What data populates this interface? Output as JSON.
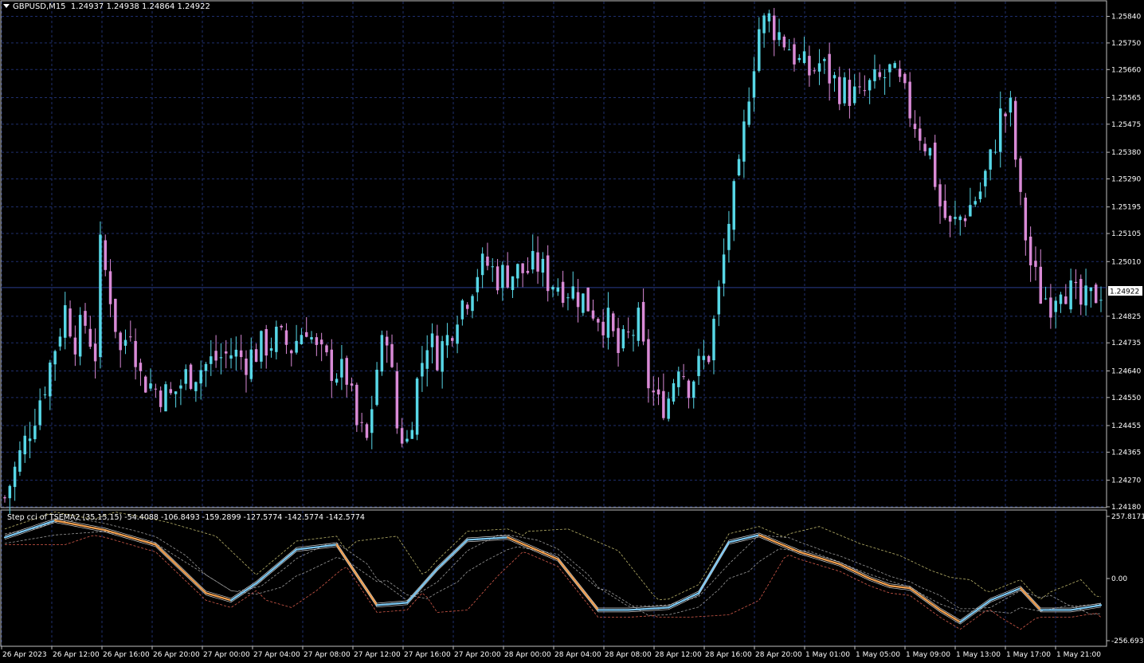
{
  "header": {
    "symbol": "GBPUSD,M15",
    "ohlc": "1.24937 1.24938 1.24864 1.24922"
  },
  "colors": {
    "background": "#000000",
    "grid": "#1f2f6e",
    "axis": "#c0c0c0",
    "bull_candle": "#57d7e6",
    "bear_candle": "#d98ad6",
    "current_price_line": "#2a3c8c",
    "cci_up": "#7dc8f2",
    "cci_down": "#f2a050",
    "band_yellow": "#b9b26a",
    "band_white": "#9a9a9a",
    "band_red": "#d35a4a"
  },
  "price_axis": {
    "labels": [
      "1.25840",
      "1.25750",
      "1.25660",
      "1.25565",
      "1.25475",
      "1.25380",
      "1.25290",
      "1.25195",
      "1.25105",
      "1.25010",
      "1.24825",
      "1.24735",
      "1.24640",
      "1.24550",
      "1.24455",
      "1.24365",
      "1.24270",
      "1.24180"
    ],
    "current_price": "1.24922"
  },
  "time_axis": {
    "labels": [
      "26 Apr 2023",
      "26 Apr 12:00",
      "26 Apr 16:00",
      "26 Apr 20:00",
      "27 Apr 00:00",
      "27 Apr 04:00",
      "27 Apr 08:00",
      "27 Apr 12:00",
      "27 Apr 16:00",
      "27 Apr 20:00",
      "28 Apr 00:00",
      "28 Apr 04:00",
      "28 Apr 08:00",
      "28 Apr 12:00",
      "28 Apr 16:00",
      "28 Apr 20:00",
      "1 May 01:00",
      "1 May 05:00",
      "1 May 09:00",
      "1 May 13:00",
      "1 May 17:00",
      "1 May 21:00"
    ]
  },
  "indicator": {
    "title": "Step cci of TSEMA2 (35,15,15) -54.4088 -106.8493 -159.2899 -127.5774 -142.5774 -142.5774",
    "axis_labels": [
      "257.8171",
      "0.00",
      "-256.6939"
    ]
  },
  "chart_data": {
    "type": "candlestick",
    "symbol": "GBPUSD",
    "timeframe": "M15",
    "ylim": [
      1.2418,
      1.2589
    ],
    "close_path": [
      [
        0,
        1.2421
      ],
      [
        4,
        1.244
      ],
      [
        8,
        1.246
      ],
      [
        12,
        1.2485
      ],
      [
        14,
        1.2475
      ],
      [
        16,
        1.248
      ],
      [
        18,
        1.247
      ],
      [
        19,
        1.2505
      ],
      [
        21,
        1.249
      ],
      [
        23,
        1.247
      ],
      [
        25,
        1.248
      ],
      [
        27,
        1.2462
      ],
      [
        30,
        1.2458
      ],
      [
        33,
        1.2455
      ],
      [
        36,
        1.2462
      ],
      [
        39,
        1.2465
      ],
      [
        42,
        1.2468
      ],
      [
        45,
        1.247
      ],
      [
        48,
        1.2468
      ],
      [
        51,
        1.2472
      ],
      [
        54,
        1.2475
      ],
      [
        57,
        1.2472
      ],
      [
        60,
        1.248
      ],
      [
        62,
        1.247
      ],
      [
        65,
        1.2465
      ],
      [
        68,
        1.2462
      ],
      [
        70,
        1.2445
      ],
      [
        72,
        1.244
      ],
      [
        74,
        1.2465
      ],
      [
        76,
        1.2478
      ],
      [
        78,
        1.2445
      ],
      [
        80,
        1.244
      ],
      [
        82,
        1.246
      ],
      [
        84,
        1.2475
      ],
      [
        86,
        1.247
      ],
      [
        88,
        1.2475
      ],
      [
        90,
        1.2485
      ],
      [
        92,
        1.249
      ],
      [
        94,
        1.2498
      ],
      [
        96,
        1.25
      ],
      [
        98,
        1.2496
      ],
      [
        100,
        1.2497
      ],
      [
        104,
        1.2498
      ],
      [
        106,
        1.25
      ],
      [
        108,
        1.2495
      ],
      [
        111,
        1.2493
      ],
      [
        114,
        1.249
      ],
      [
        117,
        1.2485
      ],
      [
        120,
        1.248
      ],
      [
        122,
        1.247
      ],
      [
        124,
        1.2475
      ],
      [
        126,
        1.248
      ],
      [
        128,
        1.246
      ],
      [
        130,
        1.2452
      ],
      [
        132,
        1.2455
      ],
      [
        134,
        1.2468
      ],
      [
        136,
        1.246
      ],
      [
        138,
        1.2465
      ],
      [
        140,
        1.247
      ],
      [
        142,
        1.249
      ],
      [
        144,
        1.2515
      ],
      [
        146,
        1.253
      ],
      [
        148,
        1.256
      ],
      [
        150,
        1.258
      ],
      [
        152,
        1.2583
      ],
      [
        154,
        1.2578
      ],
      [
        156,
        1.2574
      ],
      [
        158,
        1.2568
      ],
      [
        160,
        1.2565
      ],
      [
        162,
        1.2568
      ],
      [
        164,
        1.2564
      ],
      [
        166,
        1.256
      ],
      [
        168,
        1.2558
      ],
      [
        170,
        1.2556
      ],
      [
        172,
        1.256
      ],
      [
        174,
        1.2562
      ],
      [
        176,
        1.2565
      ],
      [
        178,
        1.256
      ],
      [
        180,
        1.2552
      ],
      [
        182,
        1.2545
      ],
      [
        184,
        1.2538
      ],
      [
        186,
        1.252
      ],
      [
        188,
        1.2512
      ],
      [
        190,
        1.2516
      ],
      [
        192,
        1.252
      ],
      [
        194,
        1.2525
      ],
      [
        196,
        1.2535
      ],
      [
        198,
        1.255
      ],
      [
        200,
        1.2552
      ],
      [
        202,
        1.252
      ],
      [
        204,
        1.25
      ],
      [
        206,
        1.249
      ],
      [
        208,
        1.2488
      ],
      [
        210,
        1.2495
      ],
      [
        212,
        1.249
      ],
      [
        214,
        1.2486
      ],
      [
        216,
        1.2488
      ],
      [
        218,
        1.2492
      ]
    ],
    "candle_count": 219,
    "cci_path": [
      [
        0,
        170
      ],
      [
        10,
        240
      ],
      [
        20,
        200
      ],
      [
        30,
        140
      ],
      [
        40,
        -60
      ],
      [
        45,
        -90
      ],
      [
        50,
        -20
      ],
      [
        58,
        120
      ],
      [
        66,
        140
      ],
      [
        74,
        -110
      ],
      [
        80,
        -100
      ],
      [
        86,
        40
      ],
      [
        92,
        160
      ],
      [
        100,
        170
      ],
      [
        110,
        80
      ],
      [
        118,
        -130
      ],
      [
        124,
        -130
      ],
      [
        132,
        -120
      ],
      [
        138,
        -60
      ],
      [
        144,
        150
      ],
      [
        150,
        180
      ],
      [
        158,
        110
      ],
      [
        166,
        60
      ],
      [
        172,
        0
      ],
      [
        176,
        -30
      ],
      [
        180,
        -40
      ],
      [
        186,
        -130
      ],
      [
        190,
        -180
      ],
      [
        196,
        -90
      ],
      [
        202,
        -40
      ],
      [
        206,
        -130
      ],
      [
        212,
        -130
      ],
      [
        218,
        -110
      ]
    ]
  }
}
